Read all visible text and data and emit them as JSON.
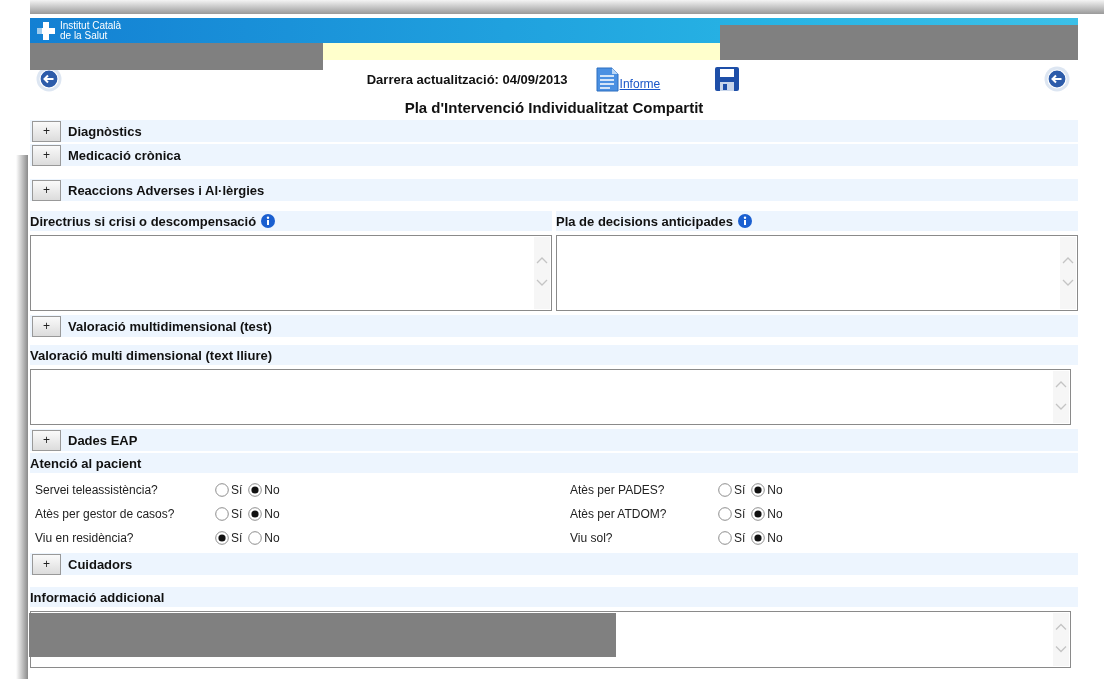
{
  "header": {
    "logo_lines": [
      "Institut Català",
      "de la Salut"
    ]
  },
  "nav": {
    "last_update": "Darrera actualització: 04/09/2013",
    "report_link": "Informe"
  },
  "title": "Pla d'Intervenció Individualitzat Compartit",
  "blocks": [
    {
      "kind": "collapsible",
      "toggle": "+",
      "label": "Diagnòstics"
    },
    {
      "kind": "collapsible",
      "toggle": "+",
      "label": "Medicació crònica"
    },
    {
      "kind": "collapsible",
      "toggle": "+",
      "label": "Reaccions Adverses i Al·lèrgies"
    },
    {
      "kind": "text_pair",
      "fields": [
        {
          "label": "Directrius si crisi o descompensació",
          "info": true
        },
        {
          "label": "Pla de decisions anticipades",
          "info": true
        }
      ]
    },
    {
      "kind": "collapsible",
      "toggle": "+",
      "label": "Valoració multidimensional (test)"
    },
    {
      "kind": "text_field",
      "label": "Valoració multi dimensional (text lliure)",
      "redacted": false
    },
    {
      "kind": "collapsible",
      "toggle": "+",
      "label": "Dades EAP"
    },
    {
      "kind": "radio_group",
      "title": "Atenció al pacient",
      "columns": [
        [
          {
            "label": "Servei teleassistència?",
            "options": [
              {
                "label": "Sí",
                "selected": false
              },
              {
                "label": "No",
                "selected": true
              }
            ]
          },
          {
            "label": "Atès per gestor de casos?",
            "options": [
              {
                "label": "Sí",
                "selected": false
              },
              {
                "label": "No",
                "selected": true
              }
            ]
          },
          {
            "label": "Viu en residència?",
            "options": [
              {
                "label": "Sí",
                "selected": true
              },
              {
                "label": "No",
                "selected": false
              }
            ]
          }
        ],
        [
          {
            "label": "Atès per PADES?",
            "options": [
              {
                "label": "Sí",
                "selected": false
              },
              {
                "label": "No",
                "selected": true
              }
            ]
          },
          {
            "label": "Atès per ATDOM?",
            "options": [
              {
                "label": "Sí",
                "selected": false
              },
              {
                "label": "No",
                "selected": true
              }
            ]
          },
          {
            "label": "Viu sol?",
            "options": [
              {
                "label": "Sí",
                "selected": false
              },
              {
                "label": "No",
                "selected": true
              }
            ]
          }
        ]
      ]
    },
    {
      "kind": "collapsible",
      "toggle": "+",
      "label": "Cuidadors"
    },
    {
      "kind": "text_field",
      "label": "Informació addicional",
      "redacted": true
    }
  ]
}
